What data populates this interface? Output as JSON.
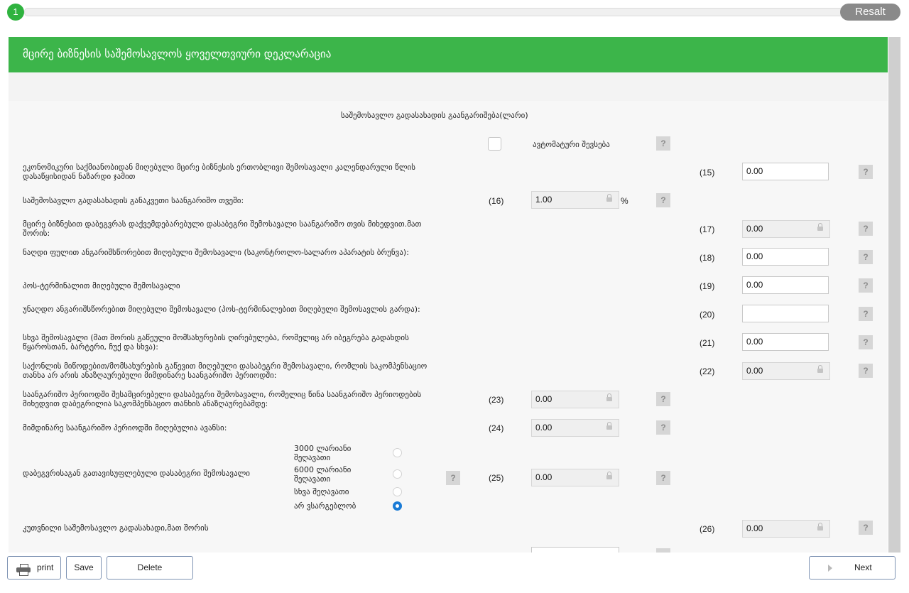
{
  "progress": {
    "step": "1",
    "result_label": "Resalt"
  },
  "form": {
    "title": "მცირე ბიზნესის საშემოსავლოს ყოველთვიური დეკლარაცია",
    "section_title": "საშემოსავლო გადასახადის გაანგარიშება(ლარი)",
    "autofill_label": "ავტომატური შევსება",
    "help_glyph": "?",
    "percent_sign": "%",
    "rows": [
      {
        "label": "ეკონომიკური საქმიანობიდან მიღებული მცირე ბიზნესის ერთობლივი შემოსავალი კალენდარული წლის დასაწყისიდან ნაზარდი ჯამით",
        "code": "(15)",
        "value": "0.00"
      },
      {
        "label": "საშემოსავლო გადასახადის განაკვეთი საანგარიშო თვეში:",
        "code": "(16)",
        "value": "1.00"
      },
      {
        "label": "მცირე ბიზნესით დაბეგვრას დაქვემდებარებული დასაბეგრი შემოსავალი საანგარიშო თვის მიხედვით.მათ შორის:",
        "code": "(17)",
        "value": "0.00"
      },
      {
        "label": "ნაღდი ფულით ანგარიშსწორებით მიღებული შემოსავალი (საკონტროლო-სალარო აპარატის ბრუნვა):",
        "code": "(18)",
        "value": "0.00"
      },
      {
        "label": "პოს-ტერმინალით მიღებული შემოსავალი",
        "code": "(19)",
        "value": "0.00"
      },
      {
        "label": "უნაღდო ანგარიშსწორებით მიღებული შემოსავალი (პოს-ტერმინალებით მიღებული შემოსავლის გარდა):",
        "code": "(20)",
        "value": ""
      },
      {
        "label": "სხვა შემოსავალი (მათ შორის გაწეული მომსახურების ღირებულება, რომელიც არ იბეგრება გადახდის წყაროსთან, ბარტერი, ჩუქ და სხვა):",
        "code": "(21)",
        "value": "0.00"
      },
      {
        "label": "საქონლის მიწოდებით/მომსახურების გაწევით მიღებული დასაბეგრი შემოსავალი, რომლის საკომპენსაციო თანხა არ არის ანაზღაურებული მიმდინარე საანგარიშო პერიოდში:",
        "code": "(22)",
        "value": "0.00"
      },
      {
        "label": "საანგარიშო პერიოდში შესამცირებელი დასაბეგრი შემოსავალი, რომელიც წინა საანგარიშო პერიოდების მიხედვით დაბეგრილია საკომპენსაციო თანხის ანაზღაურებამდე:",
        "code": "(23)",
        "value": "0.00"
      },
      {
        "label": "მიმდინარე საანგარიშო პერიოდში მიღებულია ავანსი:",
        "code": "(24)",
        "value": "0.00"
      },
      {
        "label": "დაბეგვრისაგან გათავისუფლებული დასაბეგრი შემოსავალი",
        "code": "(25)",
        "value": "0.00"
      },
      {
        "label": "კუთვნილი საშემოსავლო გადასახადი,მათ შორის",
        "code": "(26)",
        "value": "0.00"
      }
    ],
    "exemption_options": [
      {
        "label": "3000 ლარიანი შეღავათი",
        "selected": false
      },
      {
        "label": "6000 ლარიანი შეღავათი",
        "selected": false
      },
      {
        "label": "სხვა შეღავათი",
        "selected": false
      },
      {
        "label": "არ ვსარგებლობ",
        "selected": true
      }
    ]
  },
  "footer": {
    "print_label": "print",
    "save_label": "Save",
    "delete_label": "Delete",
    "next_label": "Next"
  },
  "colors": {
    "header_green": "#3cb54a",
    "step_green": "#2fb33f",
    "radio_blue": "#1a7bd6"
  }
}
